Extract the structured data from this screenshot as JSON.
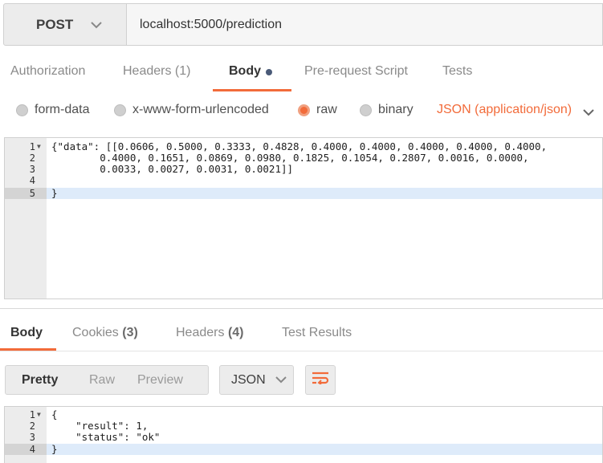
{
  "request": {
    "method": "POST",
    "url": "localhost:5000/prediction"
  },
  "request_tabs": [
    {
      "label": "Authorization"
    },
    {
      "label": "Headers (1)"
    },
    {
      "label": "Body"
    },
    {
      "label": "Pre-request Script"
    },
    {
      "label": "Tests"
    }
  ],
  "body_types": {
    "options": [
      "form-data",
      "x-www-form-urlencoded",
      "raw",
      "binary"
    ],
    "selected": "raw",
    "content_type": "JSON (application/json)"
  },
  "request_body": {
    "line_numbers": [
      "1",
      "2",
      "3",
      "4",
      "5"
    ],
    "lines": [
      "{\"data\": [[0.0606, 0.5000, 0.3333, 0.4828, 0.4000, 0.4000, 0.4000, 0.4000, 0.4000,",
      "        0.4000, 0.1651, 0.0869, 0.0980, 0.1825, 0.1054, 0.2807, 0.0016, 0.0000,",
      "        0.0033, 0.0027, 0.0031, 0.0021]]",
      "",
      "}"
    ]
  },
  "response_tabs": [
    {
      "label": "Body",
      "count": ""
    },
    {
      "label": "Cookies",
      "count": "(3)"
    },
    {
      "label": "Headers",
      "count": "(4)"
    },
    {
      "label": "Test Results",
      "count": ""
    }
  ],
  "view_modes": [
    "Pretty",
    "Raw",
    "Preview"
  ],
  "response_format": "JSON",
  "response_body": {
    "line_numbers": [
      "1",
      "2",
      "3",
      "4"
    ],
    "lines": [
      "{",
      "    \"result\": 1,",
      "    \"status\": \"ok\"",
      "}"
    ]
  },
  "colors": {
    "accent": "#f26b3a",
    "highlight_line": "#deebfa",
    "gutter": "#ececec"
  }
}
